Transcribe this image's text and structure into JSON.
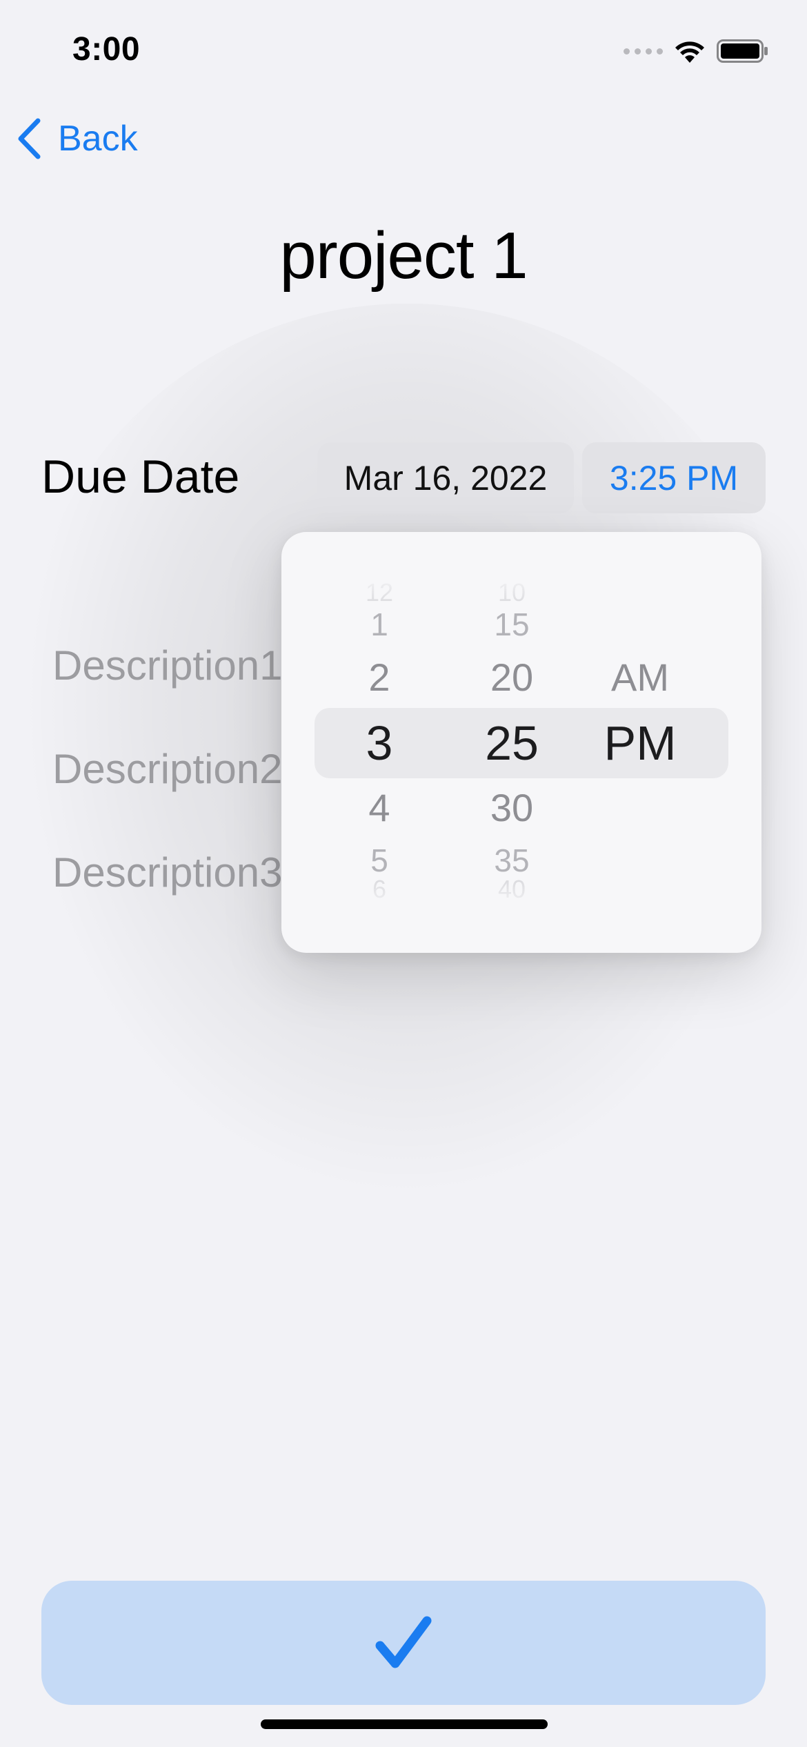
{
  "status_bar": {
    "time": "3:00",
    "icons": [
      "signal-icon",
      "wifi-icon",
      "battery-icon"
    ]
  },
  "nav": {
    "back_label": "Back",
    "back_icon": "chevron-left-icon"
  },
  "page": {
    "title": "project 1"
  },
  "due_date": {
    "label": "Due Date",
    "date_value": "Mar 16, 2022",
    "time_value": "3:25 PM"
  },
  "descriptions": [
    "Description1",
    "Description2",
    "Description3"
  ],
  "time_picker": {
    "hours": {
      "above_3": "12",
      "above_2": "1",
      "above_1": "2",
      "selected": "3",
      "below_1": "4",
      "below_2": "5",
      "below_3": "6"
    },
    "minutes": {
      "above_3": "10",
      "above_2": "15",
      "above_1": "20",
      "selected": "25",
      "below_1": "30",
      "below_2": "35",
      "below_3": "40"
    },
    "period": {
      "above_1": "AM",
      "selected": "PM"
    }
  },
  "actions": {
    "confirm_icon": "checkmark-icon"
  },
  "colors": {
    "accent": "#1a7cf0",
    "background": "#f2f2f6",
    "button_fill": "#c5daf6",
    "pill_fill": "#e2e2e6"
  }
}
